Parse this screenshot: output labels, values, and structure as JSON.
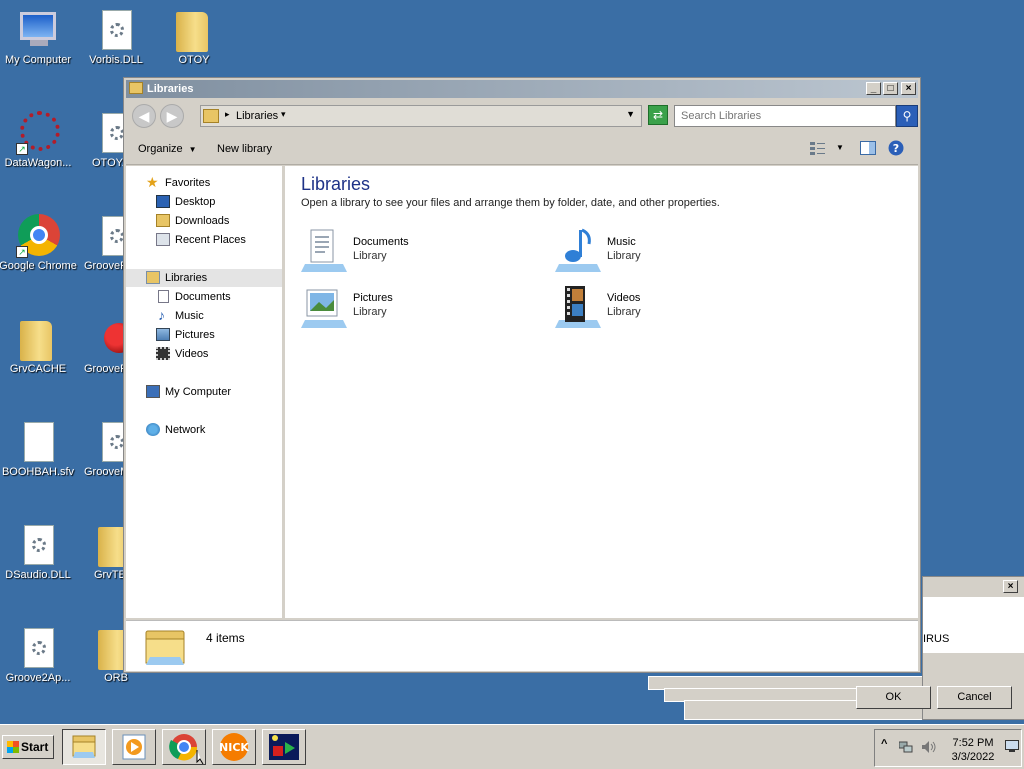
{
  "desktop": {
    "icons": [
      {
        "label": "My Computer"
      },
      {
        "label": "Vorbis.DLL"
      },
      {
        "label": "OTOY"
      },
      {
        "label": "DataWagon..."
      },
      {
        "label": "OTOY..."
      },
      {
        "label": "Google Chrome"
      },
      {
        "label": "GrooveR"
      },
      {
        "label": "GrvCACHE"
      },
      {
        "label": "GrooveR"
      },
      {
        "label": "BOOHBAH.sfv"
      },
      {
        "label": "GrooveM"
      },
      {
        "label": "DSaudio.DLL"
      },
      {
        "label": "GrvTE"
      },
      {
        "label": "Groove2Ap..."
      },
      {
        "label": "ORB"
      }
    ]
  },
  "window": {
    "title": "Libraries",
    "controls": {
      "minimize": "_",
      "maximize": "□",
      "close": "×"
    },
    "address": {
      "crumb": "Libraries"
    },
    "search": {
      "placeholder": "Search Libraries"
    },
    "toolbar": {
      "organize": "Organize",
      "new_library": "New library"
    },
    "nav": {
      "favorites_header": "Favorites",
      "favorites": [
        "Desktop",
        "Downloads",
        "Recent Places"
      ],
      "libraries_header": "Libraries",
      "libraries": [
        "Documents",
        "Music",
        "Pictures",
        "Videos"
      ],
      "computer": "My Computer",
      "network": "Network"
    },
    "content": {
      "title": "Libraries",
      "subtitle": "Open a library to see your files and arrange them by folder, date, and other properties.",
      "libraries": [
        {
          "name": "Documents",
          "type": "Library",
          "icon": "documents-library-icon"
        },
        {
          "name": "Music",
          "type": "Library",
          "icon": "music-library-icon"
        },
        {
          "name": "Pictures",
          "type": "Library",
          "icon": "pictures-library-icon"
        },
        {
          "name": "Videos",
          "type": "Library",
          "icon": "videos-library-icon"
        }
      ]
    },
    "status": {
      "count": "4 items"
    }
  },
  "dialog": {
    "close": "×",
    "partial_text": "IRUS",
    "ok": "OK",
    "cancel": "Cancel"
  },
  "taskbar": {
    "start": "Start",
    "apps": [
      "explorer-icon",
      "media-player-icon",
      "chrome-icon",
      "nick-icon",
      "app-icon"
    ],
    "nick_text": "NICK",
    "tray": {
      "chevron": "^"
    },
    "clock": {
      "time": "7:52 PM",
      "date": "3/3/2022"
    }
  },
  "colors": {
    "desktop": "#3a6ea5",
    "title_text": "#1e3287"
  }
}
